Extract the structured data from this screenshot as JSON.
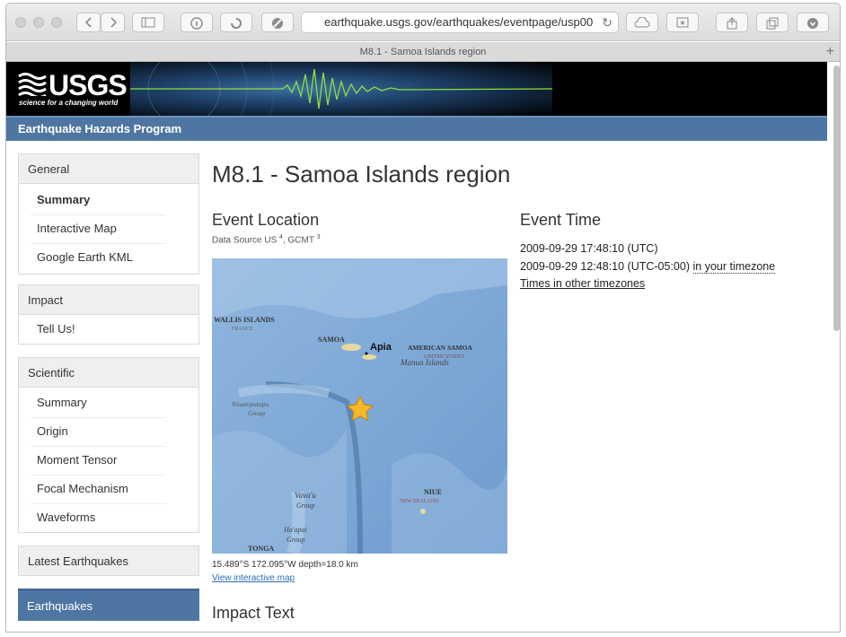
{
  "browser": {
    "url": "earthquake.usgs.gov/earthquakes/eventpage/usp00",
    "tab_title": "M8.1 - Samoa Islands region",
    "icons": [
      "close-icon",
      "minimize-icon",
      "maximize-icon",
      "back-icon",
      "forward-icon",
      "sidebar-icon",
      "info-icon",
      "pocket-icon",
      "shield-icon",
      "reload-icon",
      "cloud-icon",
      "bookmark-icon",
      "share-icon",
      "tabs-icon",
      "download-icon",
      "plus-icon"
    ]
  },
  "banner": {
    "logo": "USGS",
    "tagline": "science for a changing world",
    "program": "Earthquake Hazards Program"
  },
  "sidebar": {
    "general": {
      "title": "General",
      "items": [
        "Summary",
        "Interactive Map",
        "Google Earth KML"
      ]
    },
    "impact": {
      "title": "Impact",
      "items": [
        "Tell Us!"
      ]
    },
    "scientific": {
      "title": "Scientific",
      "items": [
        "Summary",
        "Origin",
        "Moment Tensor",
        "Focal Mechanism",
        "Waveforms"
      ]
    },
    "latest": "Latest Earthquakes",
    "earthquakes": "Earthquakes"
  },
  "main": {
    "title": "M8.1 - Samoa Islands region",
    "location": {
      "heading": "Event Location",
      "source_label": "Data Source US",
      "source_sup1": "4",
      "source_sep": ", GCMT",
      "source_sup2": "3",
      "coords": "15.489°S 172.095°W depth=18.0 km",
      "map_link": "View interactive map",
      "map_labels": {
        "wallis": "WALLIS ISLANDS",
        "france": "FRANCE",
        "samoa": "SAMOA",
        "apia": "Apia",
        "american_samoa": "AMERICAN SAMOA",
        "united_states": "UNITED STATES",
        "manua": "Manua Islands",
        "niuatoputapu": "Niuatoputapu",
        "group1": "Group",
        "vavau": "Vava'u",
        "group2": "Group",
        "niue": "NIUE",
        "new_zealand": "NEW ZEALAND",
        "haapai": "Ha'apai",
        "group3": "Group",
        "tonga": "TONGA"
      }
    },
    "time": {
      "heading": "Event Time",
      "utc": "2009-09-29 17:48:10 (UTC)",
      "local": "2009-09-29 12:48:10 (UTC-05:00)",
      "tz_link": "in your timezone",
      "other_link": "Times in other timezones"
    },
    "impact_heading": "Impact Text"
  },
  "colors": {
    "program_bar": "#4f76a3",
    "earthquakes_tab": "#4f76a3",
    "link": "#2a6ebb",
    "ocean": "#7fa9d6"
  }
}
